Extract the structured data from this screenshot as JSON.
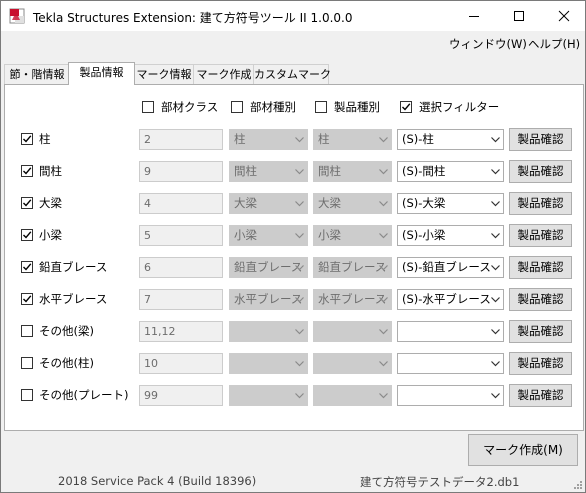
{
  "window": {
    "title": "Tekla Structures Extension: 建て方符号ツール II  1.0.0.0",
    "controls": [
      "minimize",
      "maximize",
      "close"
    ]
  },
  "menu": [
    {
      "label": "ウィンドウ(W)"
    },
    {
      "label": "ヘルプ(H)"
    }
  ],
  "tabs": [
    {
      "label": "節・階情報",
      "active": false
    },
    {
      "label": "製品情報",
      "active": true
    },
    {
      "label": "マーク情報",
      "active": false
    },
    {
      "label": "マーク作成",
      "active": false
    },
    {
      "label": "カスタムマーク",
      "active": false
    }
  ],
  "filters": [
    {
      "label": "部材クラス",
      "checked": false
    },
    {
      "label": "部材種別",
      "checked": false
    },
    {
      "label": "製品種別",
      "checked": false
    },
    {
      "label": "選択フィルター",
      "checked": true
    }
  ],
  "rows": [
    {
      "label": "柱",
      "checked": true,
      "value": "2",
      "buzai": "柱",
      "seihin": "柱",
      "filter": "(S)-柱",
      "confirm": "製品確認"
    },
    {
      "label": "間柱",
      "checked": true,
      "value": "9",
      "buzai": "間柱",
      "seihin": "間柱",
      "filter": "(S)-間柱",
      "confirm": "製品確認"
    },
    {
      "label": "大梁",
      "checked": true,
      "value": "4",
      "buzai": "大梁",
      "seihin": "大梁",
      "filter": "(S)-大梁",
      "confirm": "製品確認"
    },
    {
      "label": "小梁",
      "checked": true,
      "value": "5",
      "buzai": "小梁",
      "seihin": "小梁",
      "filter": "(S)-小梁",
      "confirm": "製品確認"
    },
    {
      "label": "鉛直ブレース",
      "checked": true,
      "value": "6",
      "buzai": "鉛直ブレース",
      "seihin": "鉛直ブレース",
      "filter": "(S)-鉛直ブレース",
      "confirm": "製品確認"
    },
    {
      "label": "水平ブレース",
      "checked": true,
      "value": "7",
      "buzai": "水平ブレース",
      "seihin": "水平ブレース",
      "filter": "(S)-水平ブレース",
      "confirm": "製品確認"
    },
    {
      "label": "その他(梁)",
      "checked": false,
      "value": "11,12",
      "buzai": "",
      "seihin": "",
      "filter": "",
      "confirm": "製品確認"
    },
    {
      "label": "その他(柱)",
      "checked": false,
      "value": "10",
      "buzai": "",
      "seihin": "",
      "filter": "",
      "confirm": "製品確認"
    },
    {
      "label": "その他(プレート)",
      "checked": false,
      "value": "99",
      "buzai": "",
      "seihin": "",
      "filter": "",
      "confirm": "製品確認"
    }
  ],
  "actions": {
    "create_mark": "マーク作成(M)"
  },
  "status": {
    "version": "2018 Service Pack 4 (Build 18396)",
    "file": "建て方符号テストデータ2.db1"
  },
  "colors": {
    "disabled_field": "#cccccc",
    "button_face": "#e1e1e1",
    "window_bg": "#f0f0f0",
    "icon_red": "#c8102e"
  }
}
